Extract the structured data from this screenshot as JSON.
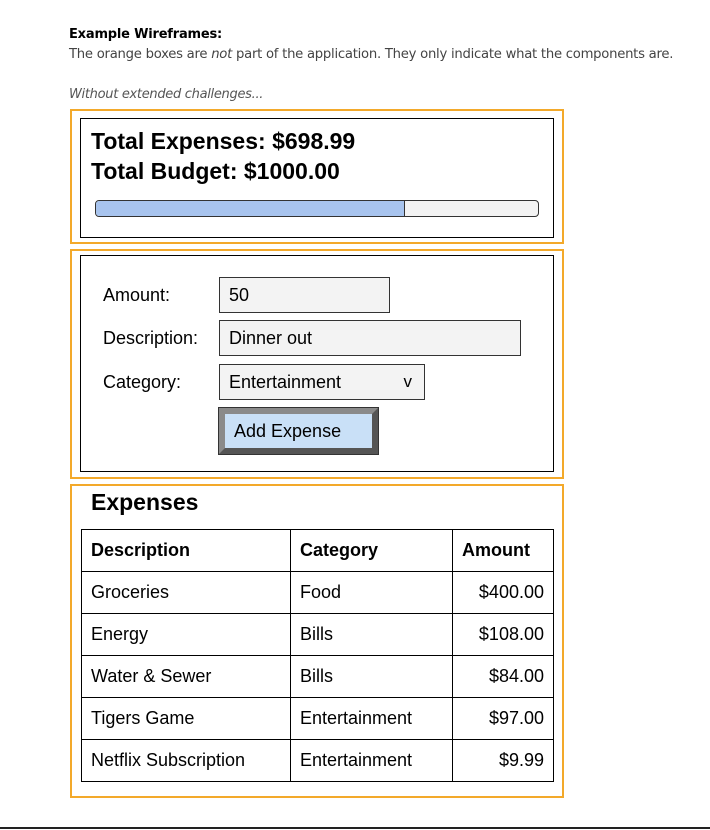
{
  "doc": {
    "heading": "Example Wireframes:",
    "note_before": "The orange boxes are ",
    "note_emphasis": "not",
    "note_after": " part of the application. They only indicate what the components are.",
    "caption": "Without extended challenges..."
  },
  "summary": {
    "total_expenses": "Total Expenses: $698.99",
    "total_budget": "Total Budget: $1000.00",
    "progress_fraction": 0.699
  },
  "form": {
    "amount_label": "Amount:",
    "amount_value": "50",
    "description_label": "Description:",
    "description_value": "Dinner out",
    "category_label": "Category:",
    "category_value": "Entertainment",
    "dropdown_glyph": "v",
    "add_button": "Add Expense"
  },
  "expenses": {
    "title": "Expenses",
    "headers": [
      "Description",
      "Category",
      "Amount"
    ],
    "rows": [
      [
        "Groceries",
        "Food",
        "$400.00"
      ],
      [
        "Energy",
        "Bills",
        "$108.00"
      ],
      [
        "Water & Sewer",
        "Bills",
        "$84.00"
      ],
      [
        "Tigers Game",
        "Entertainment",
        "$97.00"
      ],
      [
        "Netflix Subscription",
        "Entertainment",
        "$9.99"
      ]
    ]
  },
  "colors": {
    "wireframe_outline": "#f3a92a",
    "progress_fill": "#a8c4ee",
    "button_fill": "#c9e0f7"
  }
}
